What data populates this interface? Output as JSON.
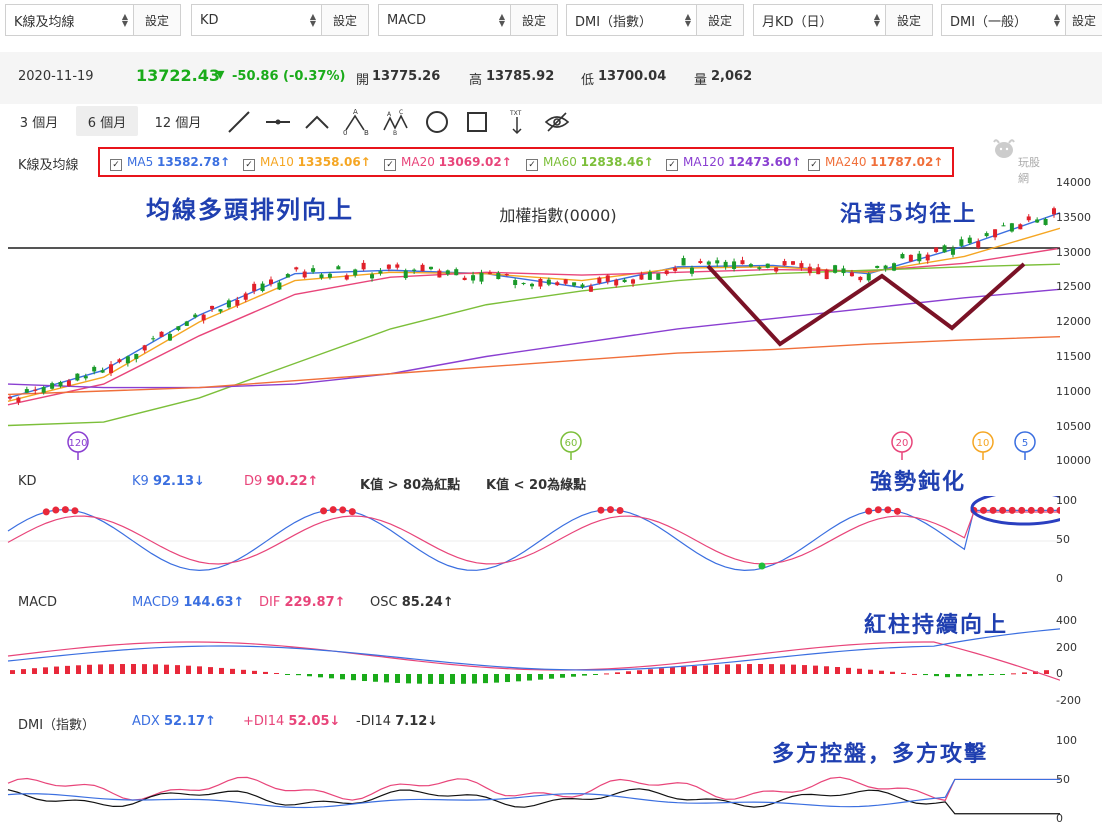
{
  "selectors": [
    {
      "value": "K線及均線",
      "button": "設定"
    },
    {
      "value": "KD",
      "button": "設定"
    },
    {
      "value": "MACD",
      "button": "設定"
    },
    {
      "value": "DMI（指數）",
      "button": "設定"
    },
    {
      "value": "月KD（日）",
      "button": "設定"
    },
    {
      "value": "DMI（一般）",
      "button": "設定"
    }
  ],
  "quote": {
    "date": "2020-11-19",
    "price": "13722.43",
    "change": "-50.86 (-0.37%)",
    "open_label": "開",
    "open": "13775.26",
    "high_label": "高",
    "high": "13785.92",
    "low_label": "低",
    "low": "13700.04",
    "vol_label": "量",
    "vol": "2,062",
    "down_color": "#1aab1a"
  },
  "ranges": [
    "3 個月",
    "6 個月",
    "12 個月"
  ],
  "active_range": "6 個月",
  "tools": [
    "line-tool-icon",
    "hline-tool-icon",
    "wedge-tool-icon",
    "abc-pattern-icon",
    "abcd-pattern-icon",
    "circle-tool-icon",
    "rect-tool-icon",
    "text-tool-icon",
    "hide-eye-icon"
  ],
  "tool_text": {
    "a": "A",
    "b": "B",
    "c": "C",
    "txt": "TXT",
    "zero": "0"
  },
  "watermark": "玩股網",
  "main": {
    "label": "K線及均線",
    "ma": [
      {
        "name": "MA5",
        "value": "13582.78↑",
        "color": "#3b6fe0"
      },
      {
        "name": "MA10",
        "value": "13358.06↑",
        "color": "#f5a623"
      },
      {
        "name": "MA20",
        "value": "13069.02↑",
        "color": "#e8457a"
      },
      {
        "name": "MA60",
        "value": "12838.46↑",
        "color": "#7cbf3a"
      },
      {
        "name": "MA120",
        "value": "12473.60↑",
        "color": "#8a3fd1"
      },
      {
        "name": "MA240",
        "value": "11787.02↑",
        "color": "#f06f3a"
      }
    ],
    "title": "加權指數(0000)",
    "yticks": [
      "14000",
      "13500",
      "13000",
      "12500",
      "12000",
      "11500",
      "11000",
      "10500",
      "10000"
    ],
    "markers": [
      {
        "text": "120",
        "color": "#8a3fd1"
      },
      {
        "text": "60",
        "color": "#7cbf3a"
      },
      {
        "text": "20",
        "color": "#e8457a"
      },
      {
        "text": "10",
        "color": "#f5a623"
      },
      {
        "text": "5",
        "color": "#3b6fe0"
      }
    ]
  },
  "annotations": {
    "ma_bull": "均線多頭排列向上",
    "along_ma5": "沿著5均往上",
    "kd_blunt": "強勢鈍化",
    "macd_up": "紅柱持續向上",
    "dmi_bull": "多方控盤，多方攻擊"
  },
  "kd": {
    "label": "KD",
    "k_name": "K9",
    "k_value": "92.13↓",
    "d_name": "D9",
    "d_value": "90.22↑",
    "note1": "K值 > 80為紅點",
    "note2": "K值 < 20為綠點",
    "yticks": [
      "100",
      "50",
      "0"
    ]
  },
  "macd": {
    "label": "MACD",
    "macd_name": "MACD9",
    "macd_value": "144.63↑",
    "dif_name": "DIF",
    "dif_value": "229.87↑",
    "osc_name": "OSC",
    "osc_value": "85.24↑",
    "yticks": [
      "400",
      "200",
      "0",
      "-200"
    ]
  },
  "dmi": {
    "label": "DMI（指數）",
    "adx_name": "ADX",
    "adx_value": "52.17↑",
    "pdi_name": "+DI14",
    "pdi_value": "52.05↓",
    "mdi_name": "-DI14",
    "mdi_value": "7.12↓",
    "yticks": [
      "100",
      "50",
      "0"
    ]
  },
  "chart_data": {
    "type": "line",
    "title": "加權指數(0000)",
    "ylim": [
      10000,
      14000
    ],
    "series": [
      {
        "name": "MA5",
        "values": [
          10900,
          11300,
          12100,
          12700,
          12750,
          12700,
          12500,
          12800,
          12820,
          12700,
          13100,
          13582.78
        ]
      },
      {
        "name": "MA10",
        "values": [
          10850,
          11200,
          12000,
          12600,
          12720,
          12700,
          12600,
          12780,
          12800,
          12720,
          12950,
          13358.06
        ]
      },
      {
        "name": "MA20",
        "values": [
          10800,
          11100,
          11800,
          12400,
          12650,
          12720,
          12680,
          12720,
          12760,
          12740,
          12850,
          13069.02
        ]
      },
      {
        "name": "MA60",
        "values": [
          10500,
          10550,
          10900,
          11400,
          11900,
          12250,
          12450,
          12600,
          12700,
          12750,
          12800,
          12838.46
        ]
      },
      {
        "name": "MA120",
        "values": [
          11100,
          11050,
          11050,
          11100,
          11250,
          11500,
          11700,
          11900,
          12050,
          12200,
          12350,
          12473.6
        ]
      },
      {
        "name": "MA240",
        "values": [
          10950,
          11000,
          11050,
          11150,
          11250,
          11350,
          11450,
          11550,
          11600,
          11680,
          11740,
          11787.02
        ]
      }
    ]
  }
}
